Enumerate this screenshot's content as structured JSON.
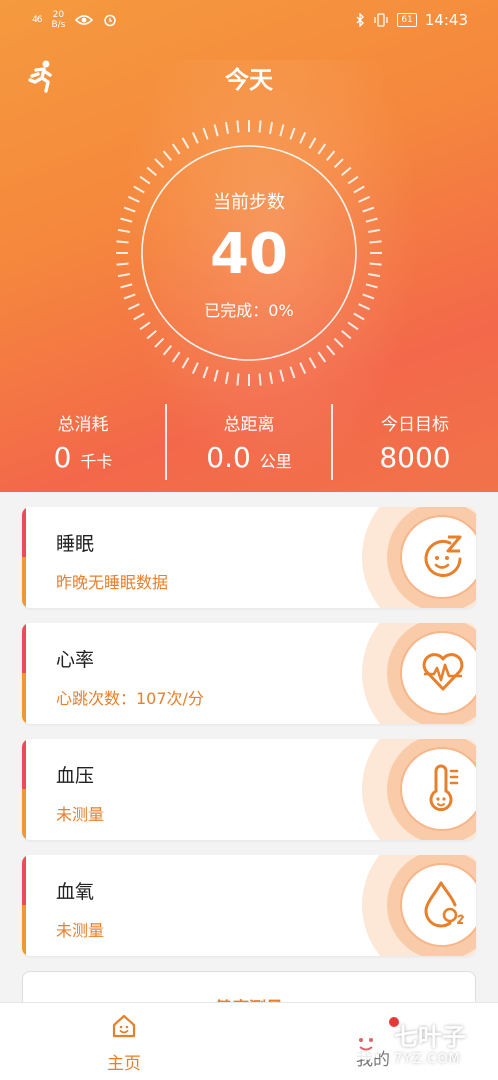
{
  "status_bar": {
    "signal": "46",
    "net_speed_top": "20",
    "net_speed_bottom": "B/s",
    "battery": "61",
    "time": "14:43"
  },
  "header": {
    "title": "今天"
  },
  "dial": {
    "label": "当前步数",
    "steps": "40",
    "completion": "已完成：0%",
    "progress": 0
  },
  "stats": [
    {
      "label": "总消耗",
      "value": "0",
      "unit": "千卡"
    },
    {
      "label": "总距离",
      "value": "0.0",
      "unit": "公里"
    },
    {
      "label": "今日目标",
      "value": "8000",
      "unit": ""
    }
  ],
  "cards": [
    {
      "title": "睡眠",
      "subtitle": "昨晚无睡眠数据",
      "icon": "sleep-face-icon"
    },
    {
      "title": "心率",
      "subtitle": "心跳次数：107次/分",
      "icon": "heart-pulse-icon"
    },
    {
      "title": "血压",
      "subtitle": "未测量",
      "icon": "thermometer-face-icon"
    },
    {
      "title": "血氧",
      "subtitle": "未测量",
      "icon": "oxygen-drop-icon"
    }
  ],
  "measure_button": {
    "label": "健康测量"
  },
  "tabbar": {
    "home_label": "主页",
    "me_label": "我的"
  },
  "watermark": {
    "main": "七叶子",
    "sub": "7YZ.COM"
  },
  "colors": {
    "accent": "#e87f2a",
    "hero_start": "#f59a3e",
    "hero_end": "#f3684a",
    "card_bar_red": "#ee4b5a",
    "card_bar_orange": "#f29632"
  }
}
